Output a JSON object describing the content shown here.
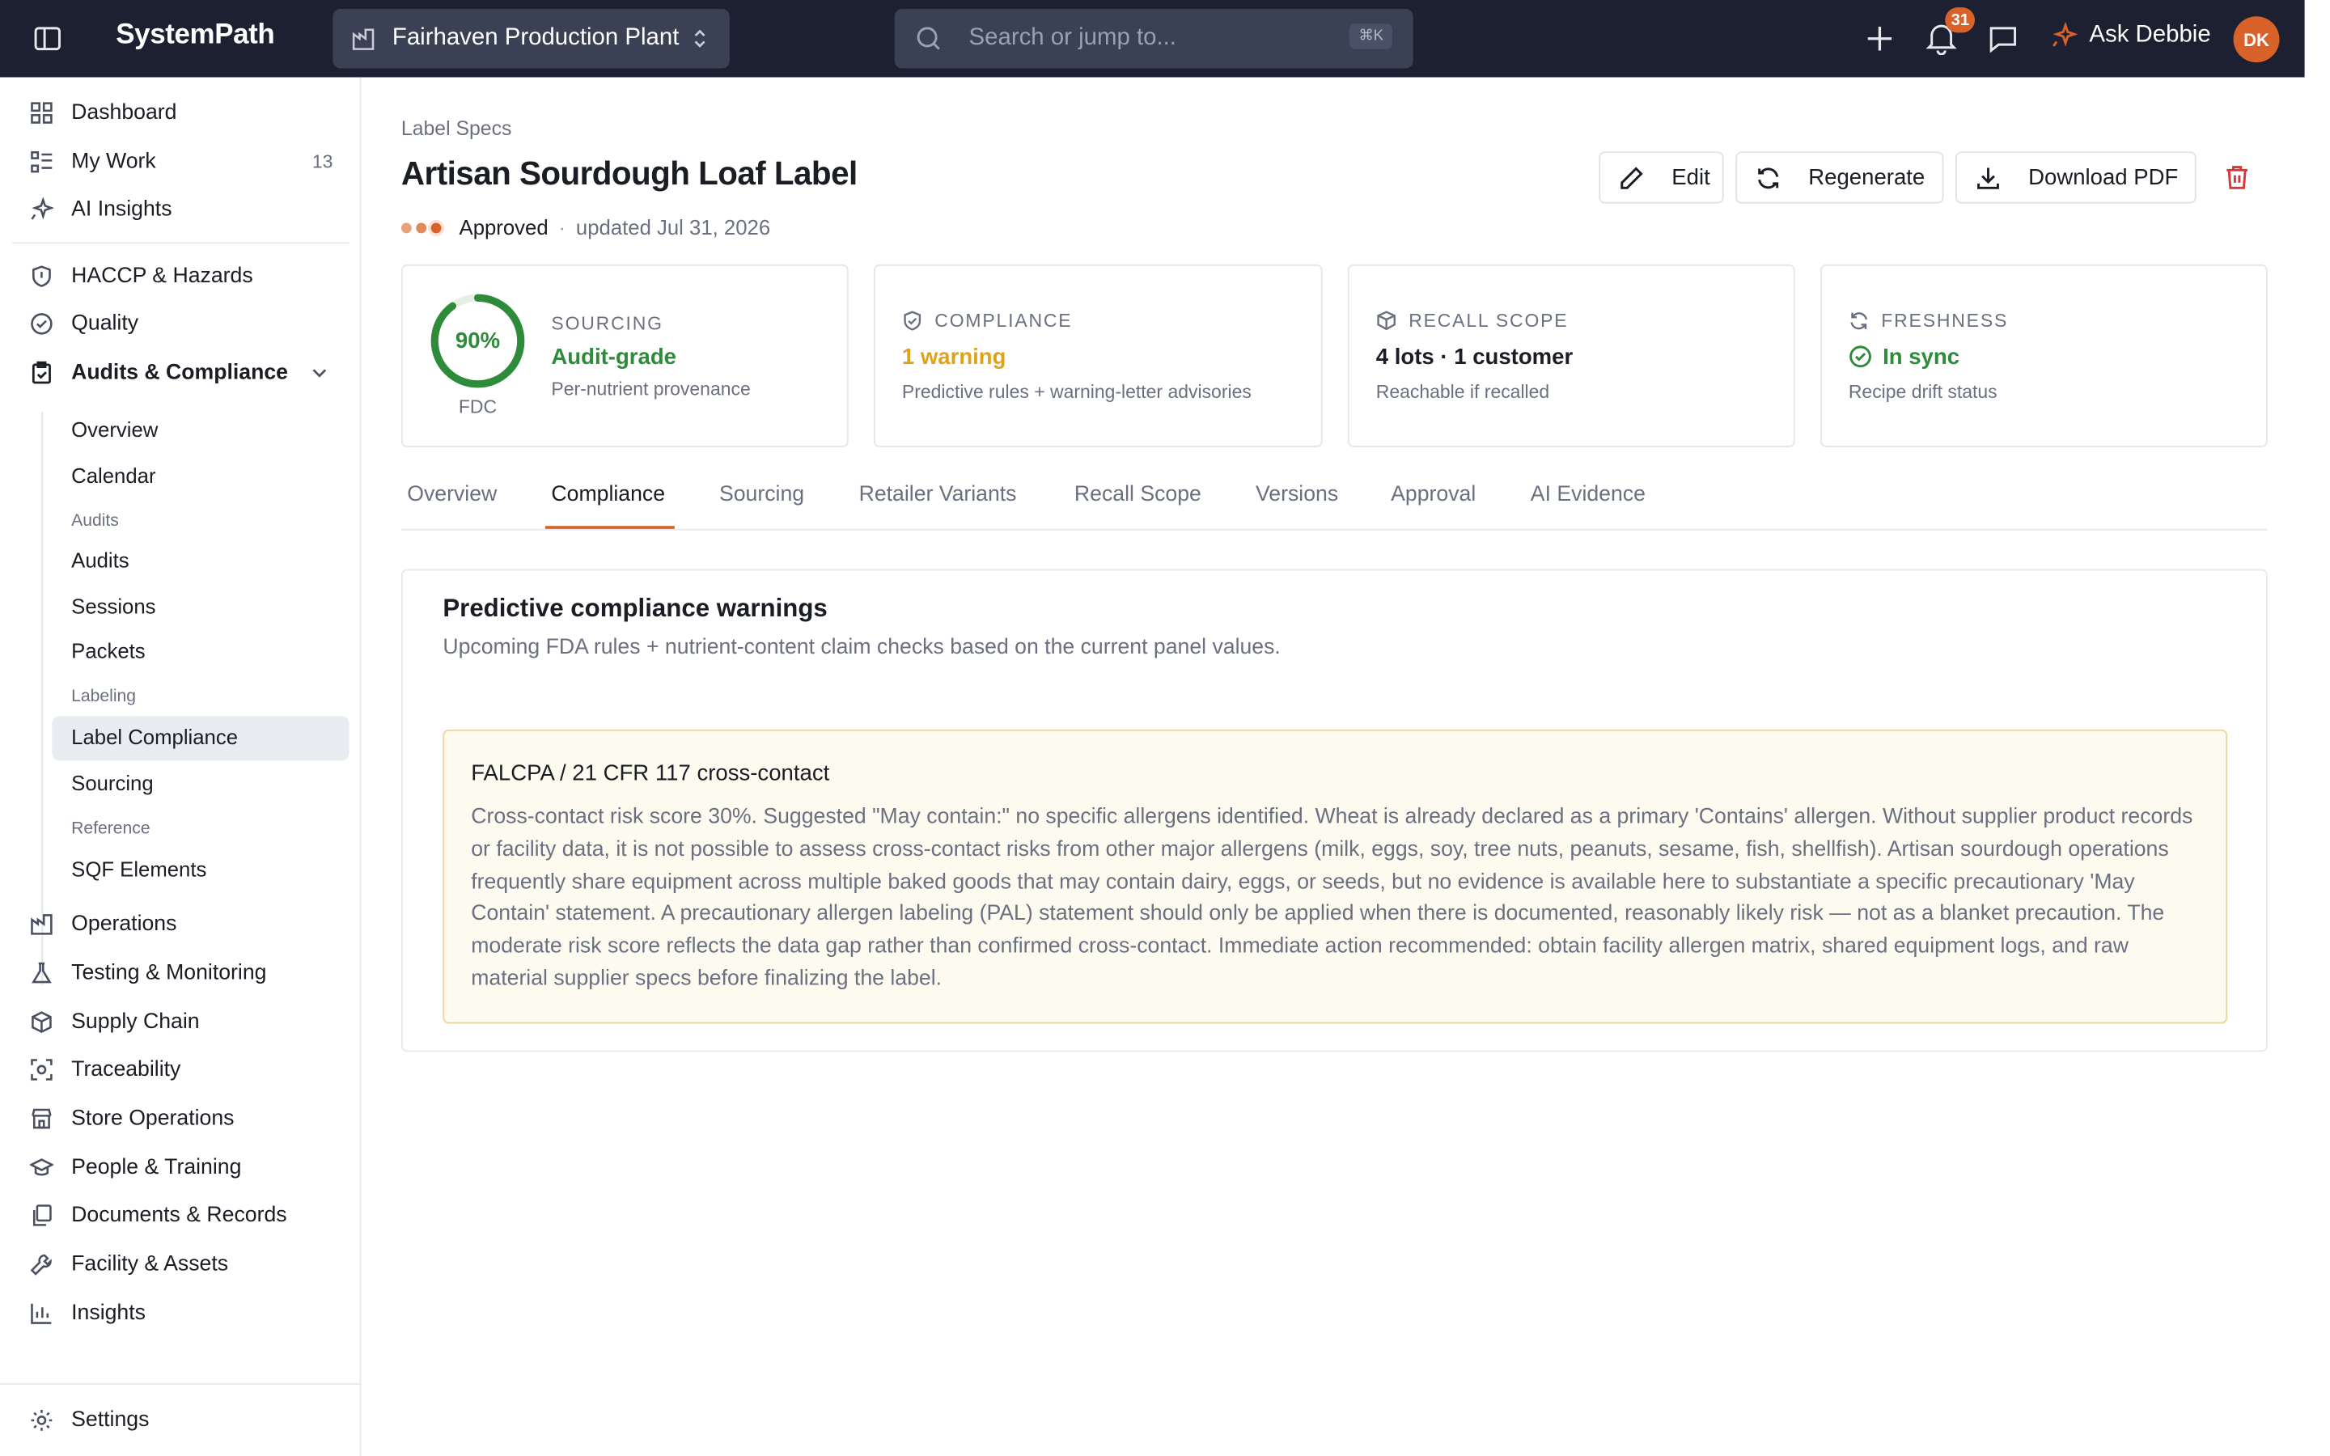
{
  "app": {
    "name": "SystemPath"
  },
  "header": {
    "plant": "Fairhaven Production Plant",
    "search_placeholder": "Search or jump to...",
    "search_shortcut": "⌘K",
    "notifications_count": "31",
    "assistant_label": "Ask Debbie",
    "avatar_initials": "DK"
  },
  "sidebar": {
    "top": [
      {
        "label": "Dashboard",
        "icon": "dashboard-icon"
      },
      {
        "label": "My Work",
        "count": "13",
        "icon": "list-icon"
      },
      {
        "label": "AI Insights",
        "icon": "sparkle-icon"
      }
    ],
    "modules": [
      {
        "label": "HACCP & Hazards",
        "icon": "shield-icon"
      },
      {
        "label": "Quality",
        "icon": "check-circle-icon"
      },
      {
        "label": "Audits & Compliance",
        "icon": "clipboard-check-icon",
        "expanded": true
      }
    ],
    "audits_sub": {
      "overview": "Overview",
      "calendar": "Calendar",
      "group_audits": "Audits",
      "audits": "Audits",
      "sessions": "Sessions",
      "packets": "Packets",
      "group_labeling": "Labeling",
      "label_compliance": "Label Compliance",
      "sourcing": "Sourcing",
      "group_reference": "Reference",
      "sqf_elements": "SQF Elements"
    },
    "rest": [
      {
        "label": "Operations",
        "icon": "factory-icon"
      },
      {
        "label": "Testing & Monitoring",
        "icon": "flask-icon"
      },
      {
        "label": "Supply Chain",
        "icon": "box-icon"
      },
      {
        "label": "Traceability",
        "icon": "scan-icon"
      },
      {
        "label": "Store Operations",
        "icon": "store-icon"
      },
      {
        "label": "People & Training",
        "icon": "graduation-cap-icon"
      },
      {
        "label": "Documents & Records",
        "icon": "documents-icon"
      },
      {
        "label": "Facility & Assets",
        "icon": "wrench-icon"
      },
      {
        "label": "Insights",
        "icon": "bar-chart-icon"
      }
    ],
    "settings": "Settings"
  },
  "page": {
    "breadcrumb": "Label Specs",
    "title": "Artisan Sourdough Loaf Label",
    "status": "Approved",
    "updated": "updated Jul 31, 2026",
    "actions": {
      "edit": "Edit",
      "regenerate": "Regenerate",
      "download": "Download PDF"
    }
  },
  "cards": {
    "sourcing": {
      "percent": 90,
      "percent_label": "90%",
      "source": "FDC",
      "label": "SOURCING",
      "value": "Audit-grade",
      "sub": "Per-nutrient provenance"
    },
    "compliance": {
      "label": "COMPLIANCE",
      "value": "1 warning",
      "sub": "Predictive rules + warning-letter advisories"
    },
    "recall": {
      "label": "RECALL SCOPE",
      "value": "4 lots · 1 customer",
      "sub": "Reachable if recalled"
    },
    "freshness": {
      "label": "FRESHNESS",
      "value": "In sync",
      "sub": "Recipe drift status"
    }
  },
  "tabs": [
    "Overview",
    "Compliance",
    "Sourcing",
    "Retailer Variants",
    "Recall Scope",
    "Versions",
    "Approval",
    "AI Evidence"
  ],
  "active_tab": "Compliance",
  "panel": {
    "title": "Predictive compliance warnings",
    "subtitle": "Upcoming FDA rules + nutrient-content claim checks based on the current panel values.",
    "warning": {
      "title": "FALCPA / 21 CFR 117 cross-contact",
      "body": "Cross-contact risk score 30%. Suggested \"May contain:\" no specific allergens identified. Wheat is already declared as a primary 'Contains' allergen. Without supplier product records or facility data, it is not possible to assess cross-contact risks from other major allergens (milk, eggs, soy, tree nuts, peanuts, sesame, fish, shellfish). Artisan sourdough operations frequently share equipment across multiple baked goods that may contain dairy, eggs, or seeds, but no evidence is available here to substantiate a specific precautionary 'May Contain' statement. A precautionary allergen labeling (PAL) statement should only be applied when there is documented, reasonably likely risk — not as a blanket precaution. The moderate risk score reflects the data gap rather than confirmed cross-contact. Immediate action recommended: obtain facility allergen matrix, shared equipment logs, and raw material supplier specs before finalizing the label."
    }
  },
  "colors": {
    "accent": "#d9622b",
    "success": "#2e8b3a",
    "warning": "#e0a21a",
    "danger": "#d93636",
    "topbar": "#1c2031"
  }
}
